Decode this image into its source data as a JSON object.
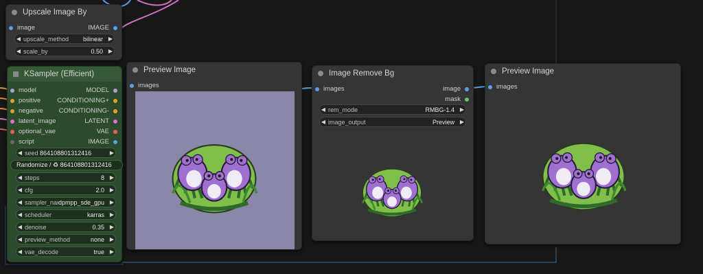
{
  "colors": {
    "canvas": "#171717",
    "node_gray": "#353535",
    "node_green": "#2c4a2c",
    "wire_blue": "#5aa0e6",
    "wire_pink": "#d070c0",
    "preview_bg": "#8b87a8"
  },
  "upscale": {
    "title": "Upscale Image By",
    "input_image": "image",
    "output_image": "IMAGE",
    "method_label": "upscale_method",
    "method_value": "bilinear",
    "scale_label": "scale_by",
    "scale_value": "0.50"
  },
  "ksampler": {
    "title": "KSampler (Efficient)",
    "inputs": [
      "model",
      "positive",
      "negative",
      "latent_image",
      "optional_vae",
      "script"
    ],
    "outputs": [
      "MODEL",
      "CONDITIONING+",
      "CONDITIONING-",
      "LATENT",
      "VAE",
      "IMAGE"
    ],
    "seed_label": "seed",
    "seed_value": "864108801312416",
    "randomize_text": "Randomize / ♻ 864108801312416",
    "steps_label": "steps",
    "steps_value": "8",
    "cfg_label": "cfg",
    "cfg_value": "2.0",
    "sampler_label": "sampler_name",
    "sampler_value": "dpmpp_sde_gpu",
    "scheduler_label": "scheduler",
    "scheduler_value": "karras",
    "denoise_label": "denoise",
    "denoise_value": "0.35",
    "preview_label": "preview_method",
    "preview_value": "none",
    "vae_label": "vae_decode",
    "vae_value": "true"
  },
  "preview1": {
    "title": "Preview Image",
    "input": "images"
  },
  "removebg": {
    "title": "Image Remove Bg",
    "input": "images",
    "out_image": "image",
    "out_mask": "mask",
    "mode_label": "rem_mode",
    "mode_value": "RMBG-1.4",
    "output_label": "image_output",
    "output_value": "Preview"
  },
  "preview2": {
    "title": "Preview Image",
    "input": "images"
  }
}
